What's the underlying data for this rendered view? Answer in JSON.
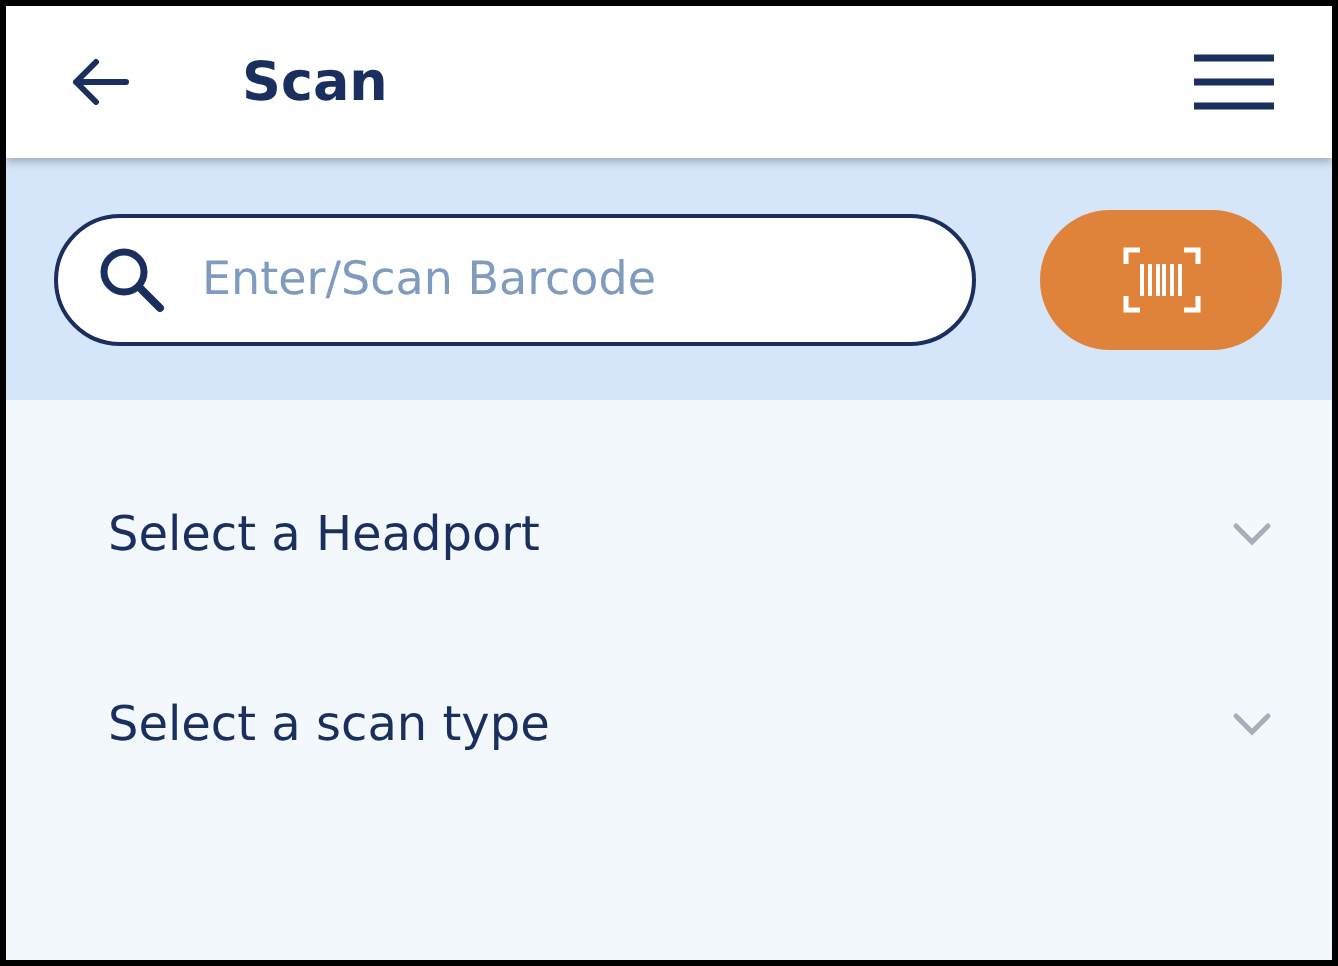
{
  "header": {
    "title": "Scan"
  },
  "search": {
    "placeholder": "Enter/Scan Barcode"
  },
  "selects": [
    {
      "placeholder": "Select a Headport"
    },
    {
      "placeholder": "Select a scan type"
    }
  ]
}
